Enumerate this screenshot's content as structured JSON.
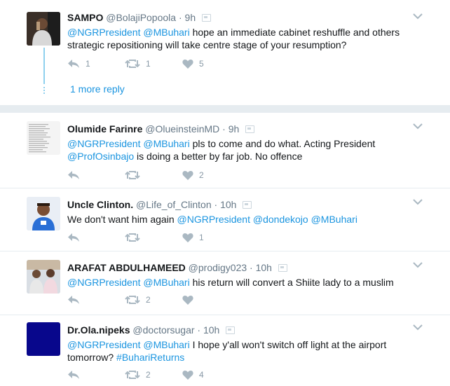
{
  "tweets": [
    {
      "name": "SAMPO",
      "handle": "@BolajiPopoola",
      "time": "9h",
      "mentions": [
        "@NGRPresident",
        "@MBuhari"
      ],
      "text": "hope an immediate cabinet reshuffle and others strategic repositioning will take centre stage of your resumption?",
      "replies": "1",
      "retweets": "1",
      "likes": "5",
      "more_replies": "1 more reply"
    },
    {
      "name": "Olumide Farinre",
      "handle": "@OlueinsteinMD",
      "time": "9h",
      "mentions": [
        "@NGRPresident",
        "@MBuhari"
      ],
      "text_part1": "pls to come and do what. Acting President",
      "mention2": "@ProfOsinbajo",
      "text_part2": "is doing a better by far job. No offence",
      "replies": "",
      "retweets": "",
      "likes": "2"
    },
    {
      "name": "Uncle Clinton.",
      "handle": "@Life_of_Clinton",
      "time": "10h",
      "text": "We don't want him again",
      "mentions": [
        "@NGRPresident",
        "@dondekojo",
        "@MBuhari"
      ],
      "replies": "",
      "retweets": "",
      "likes": "1"
    },
    {
      "name": "ARAFAT ABDULHAMEED",
      "handle": "@prodigy023",
      "time": "10h",
      "mentions": [
        "@NGRPresident",
        "@MBuhari"
      ],
      "text": "his return will convert a Shiite lady to a muslim",
      "replies": "",
      "retweets": "2",
      "likes": ""
    },
    {
      "name": "Dr.Ola.nipeks",
      "handle": "@doctorsugar",
      "time": "10h",
      "mentions": [
        "@NGRPresident",
        "@MBuhari"
      ],
      "text": "I hope y'all won't switch off light at the airport tomorrow?",
      "hashtag": "#BuhariReturns",
      "replies": "",
      "retweets": "2",
      "likes": "4"
    }
  ],
  "colors": {
    "link": "#1b95e0",
    "muted": "#657786",
    "icon": "#aab8c2",
    "thread_line": "#8fd0ee",
    "background": "#e6ecf0"
  },
  "icons": {
    "reply": "reply-icon",
    "retweet": "retweet-icon",
    "like": "heart-icon",
    "menu": "chevron-down-icon",
    "badge": "verified-placeholder-icon"
  }
}
